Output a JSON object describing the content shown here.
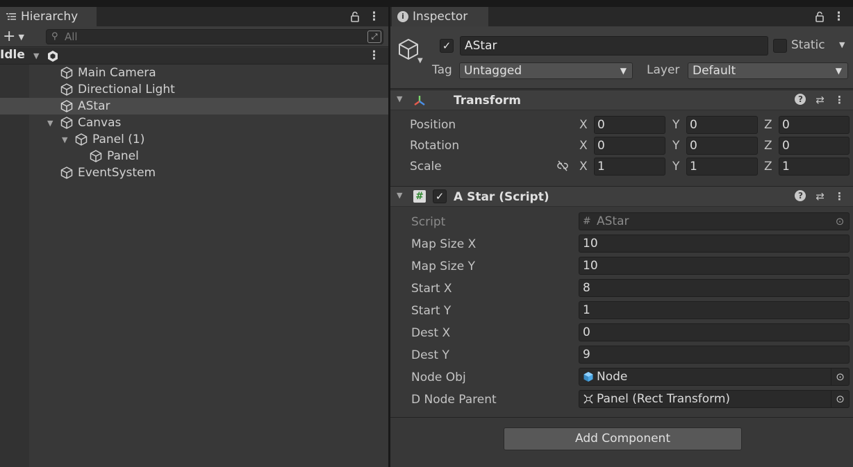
{
  "hierarchy": {
    "tab_title": "Hierarchy",
    "search_placeholder": "All",
    "scene": {
      "name": "Idle"
    },
    "items": [
      {
        "label": "Main Camera",
        "depth": 1
      },
      {
        "label": "Directional Light",
        "depth": 1
      },
      {
        "label": "AStar",
        "depth": 1,
        "selected": true
      },
      {
        "label": "Canvas",
        "depth": 1,
        "expanded": true
      },
      {
        "label": "Panel (1)",
        "depth": 2,
        "expanded": true
      },
      {
        "label": "Panel",
        "depth": 3
      },
      {
        "label": "EventSystem",
        "depth": 1
      }
    ]
  },
  "inspector": {
    "tab_title": "Inspector",
    "object": {
      "name": "AStar",
      "active": true,
      "static_label": "Static",
      "static": false,
      "tag_label": "Tag",
      "tag_value": "Untagged",
      "layer_label": "Layer",
      "layer_value": "Default"
    },
    "transform": {
      "title": "Transform",
      "rows": [
        {
          "label": "Position",
          "x": "0",
          "y": "0",
          "z": "0"
        },
        {
          "label": "Rotation",
          "x": "0",
          "y": "0",
          "z": "0"
        },
        {
          "label": "Scale",
          "x": "1",
          "y": "1",
          "z": "1"
        }
      ],
      "axes": {
        "x": "X",
        "y": "Y",
        "z": "Z"
      }
    },
    "script_component": {
      "title": "A Star (Script)",
      "enabled": true,
      "script_label": "Script",
      "script_value": "AStar",
      "fields": [
        {
          "label": "Map Size X",
          "value": "10"
        },
        {
          "label": "Map Size Y",
          "value": "10"
        },
        {
          "label": "Start X",
          "value": "8"
        },
        {
          "label": "Start Y",
          "value": "1"
        },
        {
          "label": "Dest X",
          "value": "0"
        },
        {
          "label": "Dest Y",
          "value": "9"
        }
      ],
      "node_obj": {
        "label": "Node Obj",
        "value": "Node"
      },
      "node_parent": {
        "label": "D Node Parent",
        "value": "Panel (Rect Transform)"
      }
    },
    "add_component_label": "Add Component"
  },
  "icons": {
    "hierarchy_tab": "list-icon",
    "inspector_tab": "info-icon",
    "lock": "lock-icon",
    "kebab": "kebab-menu-icon",
    "search": "search-icon",
    "gameobject": "cube-icon",
    "transform": "transform-axes-icon",
    "script": "script-hash-icon",
    "help": "help-icon",
    "presets": "sliders-icon",
    "constrain": "link-broken-icon",
    "object_picker": "target-icon",
    "prefab": "prefab-cube-icon",
    "rect_transform": "rect-transform-icon"
  },
  "colors": {
    "panel_bg": "#383838",
    "selected_row": "#4a4a4a",
    "field_bg": "#2a2a2a",
    "prefab_blue": "#4ca8e6",
    "script_green": "#6bd36b"
  }
}
